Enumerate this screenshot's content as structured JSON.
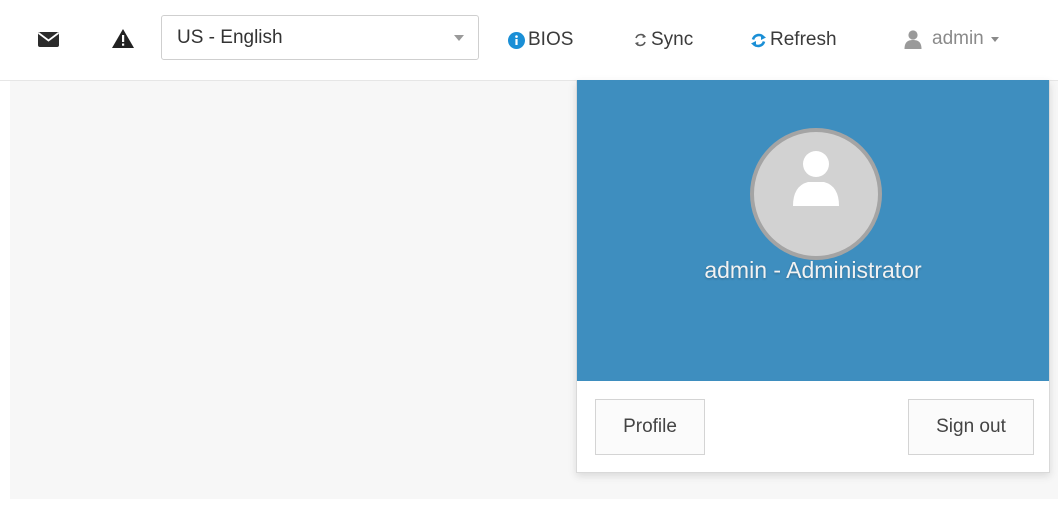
{
  "topbar": {
    "icons": {
      "messages": "envelope-icon",
      "alerts": "warning-triangle-icon"
    },
    "language_select": {
      "value": "US - English"
    },
    "bios": {
      "label": "BIOS",
      "icon": "info-circle-icon",
      "icon_color": "#1a8fd6"
    },
    "sync": {
      "label": "Sync",
      "icon": "sync-icon"
    },
    "refresh": {
      "label": "Refresh",
      "icon": "refresh-icon",
      "icon_color": "#1a8fd6"
    },
    "user_menu": {
      "label": "admin",
      "icon": "user-icon"
    }
  },
  "dropdown": {
    "header_color": "#3e8ebf",
    "user_title": "admin - Administrator",
    "profile_label": "Profile",
    "signout_label": "Sign out"
  }
}
